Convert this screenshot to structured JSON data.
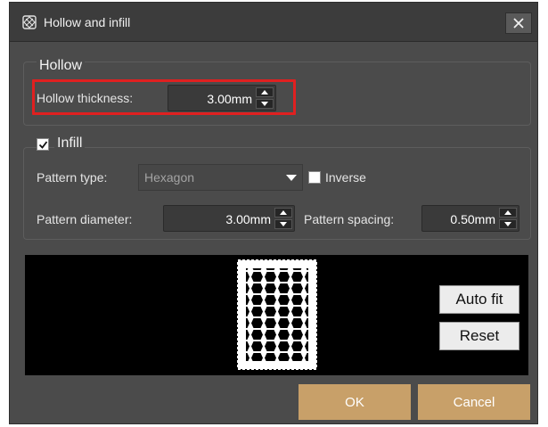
{
  "window": {
    "title": "Hollow and infill"
  },
  "hollow": {
    "group_label": "Hollow",
    "thickness_label": "Hollow thickness:",
    "thickness_value": "3.00mm"
  },
  "infill": {
    "group_label": "Infill",
    "enabled": true,
    "pattern_type_label": "Pattern type:",
    "pattern_type_value": "Hexagon",
    "inverse_label": "Inverse",
    "inverse_checked": false,
    "pattern_diameter_label": "Pattern diameter:",
    "pattern_diameter_value": "3.00mm",
    "pattern_spacing_label": "Pattern spacing:",
    "pattern_spacing_value": "0.50mm"
  },
  "preview": {
    "auto_fit_label": "Auto fit",
    "reset_label": "Reset"
  },
  "footer": {
    "ok_label": "OK",
    "cancel_label": "Cancel"
  },
  "colors": {
    "dialog_bg": "#4b4b4b",
    "titlebar_bg": "#3c3c3c",
    "accent_button": "#c8a069",
    "highlight_box": "#e02020",
    "preview_bg": "#000000"
  }
}
